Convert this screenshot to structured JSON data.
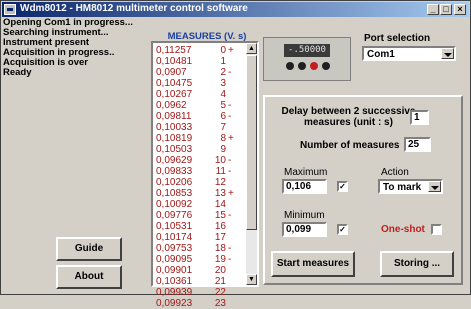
{
  "window": {
    "title": "Wdm8012 - HM8012 multimeter control software",
    "min_label": "_",
    "max_label": "□",
    "close_label": "×"
  },
  "status_lines": [
    "Opening Com1 in progress...",
    "Searching instrument...",
    "Instrument present",
    "Acquisition in progress..",
    "Acquisition is over",
    "Ready"
  ],
  "measures": {
    "title": "MEASURES (V. s)",
    "rows": [
      {
        "value": "0,11257",
        "index": "0",
        "sign": "+"
      },
      {
        "value": "0,10481",
        "index": "1",
        "sign": ""
      },
      {
        "value": "0,0907",
        "index": "2",
        "sign": "-"
      },
      {
        "value": "0,10475",
        "index": "3",
        "sign": ""
      },
      {
        "value": "0,10267",
        "index": "4",
        "sign": ""
      },
      {
        "value": "0,0962",
        "index": "5",
        "sign": "-"
      },
      {
        "value": "0,09811",
        "index": "6",
        "sign": "-"
      },
      {
        "value": "0,10033",
        "index": "7",
        "sign": ""
      },
      {
        "value": "0,10819",
        "index": "8",
        "sign": "+"
      },
      {
        "value": "0,10503",
        "index": "9",
        "sign": ""
      },
      {
        "value": "0,09629",
        "index": "10",
        "sign": "-"
      },
      {
        "value": "0,09833",
        "index": "11",
        "sign": "-"
      },
      {
        "value": "0,10206",
        "index": "12",
        "sign": ""
      },
      {
        "value": "0,10853",
        "index": "13",
        "sign": "+"
      },
      {
        "value": "0,10092",
        "index": "14",
        "sign": ""
      },
      {
        "value": "0,09776",
        "index": "15",
        "sign": "-"
      },
      {
        "value": "0,10531",
        "index": "16",
        "sign": ""
      },
      {
        "value": "0,10174",
        "index": "17",
        "sign": ""
      },
      {
        "value": "0,09753",
        "index": "18",
        "sign": "-"
      },
      {
        "value": "0,09095",
        "index": "19",
        "sign": "-"
      },
      {
        "value": "0,09901",
        "index": "20",
        "sign": ""
      },
      {
        "value": "0,10361",
        "index": "21",
        "sign": ""
      },
      {
        "value": "0,09939",
        "index": "22",
        "sign": ""
      },
      {
        "value": "0,09923",
        "index": "23",
        "sign": ""
      }
    ]
  },
  "device": {
    "display": "-.50000",
    "icon": "multimeter-image"
  },
  "port": {
    "label": "Port selection",
    "selected": "Com1"
  },
  "settings": {
    "delay_label": "Delay between 2 successive measures (unit : s)",
    "delay_line1": "Delay between 2 successive",
    "delay_line2": "measures (unit : s)",
    "delay_value": "1",
    "count_label": "Number of measures",
    "count_value": "25",
    "maximum_label": "Maximum",
    "maximum_value": "0,106",
    "maximum_checked": true,
    "minimum_label": "Minimum",
    "minimum_value": "0,099",
    "minimum_checked": true,
    "action_label": "Action",
    "action_selected": "To mark",
    "oneshot_label": "One-shot",
    "oneshot_checked": false,
    "check_mark": "✓"
  },
  "buttons": {
    "start": "Start measures",
    "storing": "Storing ...",
    "guide": "Guide",
    "about": "About"
  },
  "colors": {
    "measure_text": "#a01818",
    "title_blue": "#1a3fa0",
    "oneshot_red": "#c02020"
  }
}
